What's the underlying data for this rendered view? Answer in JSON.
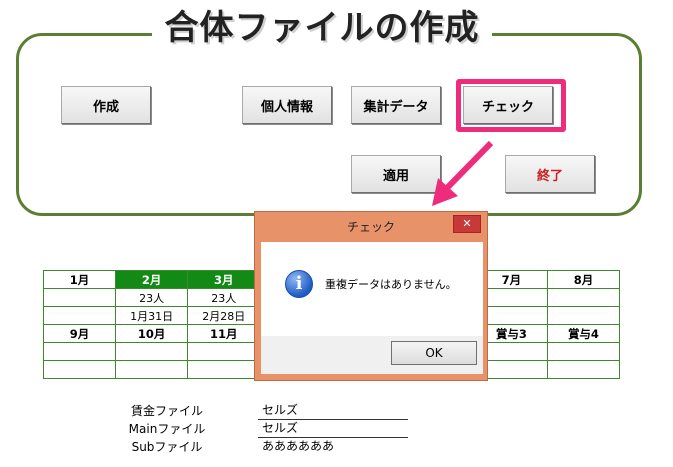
{
  "title": "合体ファイルの作成",
  "buttons": {
    "create": "作成",
    "personal": "個人情報",
    "aggregate": "集計データ",
    "check": "チェック",
    "apply": "適用",
    "exit": "終了"
  },
  "calendar": {
    "row1": [
      "1月",
      "2月",
      "3月",
      "",
      "",
      "",
      "7月",
      "8月"
    ],
    "row2": [
      "",
      "23人",
      "23人",
      "",
      "",
      "",
      "",
      ""
    ],
    "row3": [
      "",
      "1月31日",
      "2月28日",
      "",
      "",
      "",
      "",
      ""
    ],
    "row4": [
      "9月",
      "10月",
      "11月",
      "",
      "",
      "",
      "賞与3",
      "賞与4"
    ],
    "row5": [
      "",
      "",
      "",
      "",
      "",
      "",
      "",
      ""
    ],
    "row6": [
      "",
      "",
      "",
      "",
      "",
      "",
      "",
      ""
    ]
  },
  "files": [
    {
      "label": "賃金ファイル",
      "value": "セルズ"
    },
    {
      "label": "Mainファイル",
      "value": "セルズ"
    },
    {
      "label": "Subファイル",
      "value": "ああああああ"
    }
  ],
  "dialog": {
    "title": "チェック",
    "message": "重複データはありません。",
    "ok": "OK",
    "close": "✕"
  },
  "colors": {
    "frame": "#5a7f32",
    "highlight": "#ee2c7b",
    "calendarHeader": "#138a15",
    "dialog": "#e8926a"
  }
}
